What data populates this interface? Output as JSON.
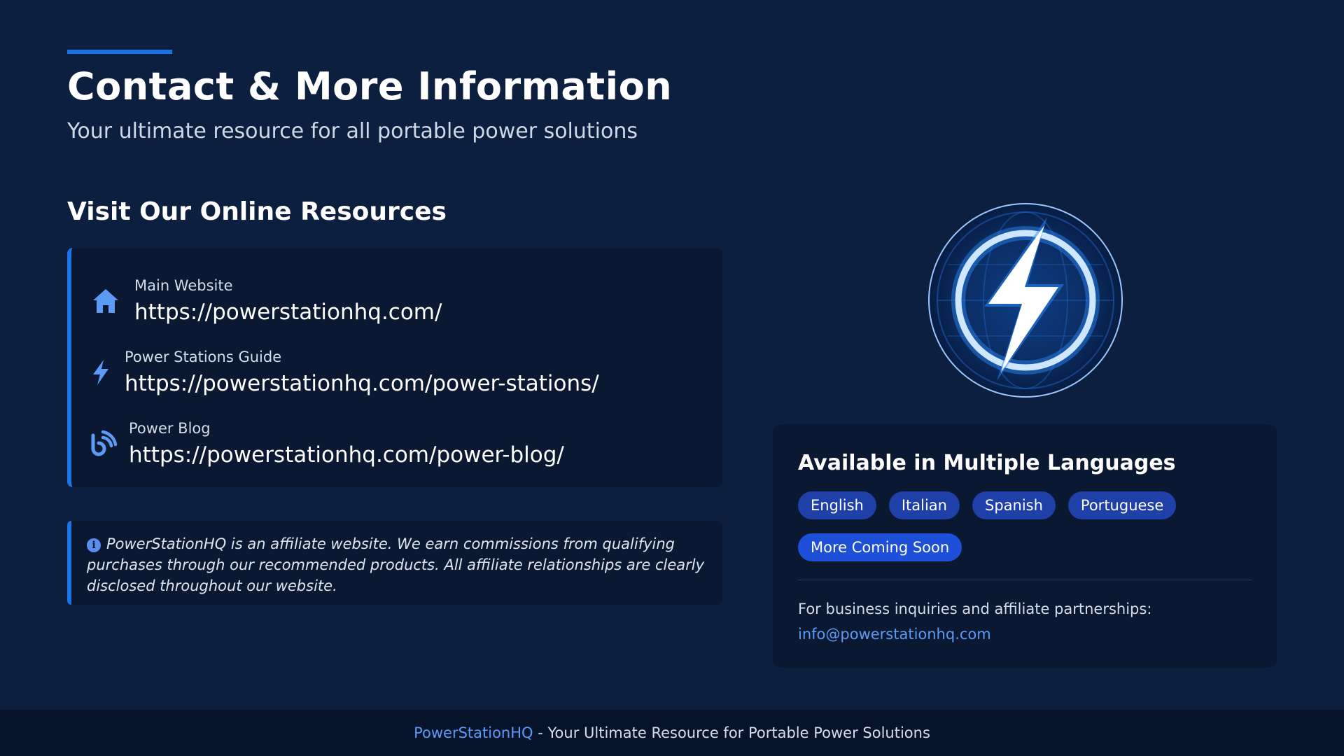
{
  "header": {
    "title": "Contact & More Information",
    "subtitle": "Your ultimate resource for all portable power solutions"
  },
  "resources": {
    "heading": "Visit Our Online Resources",
    "items": [
      {
        "label": "Main Website",
        "url": "https://powerstationhq.com/",
        "icon": "home-icon"
      },
      {
        "label": "Power Stations Guide",
        "url": "https://powerstationhq.com/power-stations/",
        "icon": "bolt-icon"
      },
      {
        "label": "Power Blog",
        "url": "https://powerstationhq.com/power-blog/",
        "icon": "blog-icon"
      }
    ]
  },
  "disclaimer": {
    "text": "PowerStationHQ is an affiliate website. We earn commissions from qualifying purchases through our recommended products. All affiliate relationships are clearly disclosed throughout our website.",
    "icon": "info-icon"
  },
  "languages": {
    "title": "Available in Multiple Languages",
    "tags": [
      "English",
      "Italian",
      "Spanish",
      "Portuguese",
      "More Coming Soon"
    ],
    "inquiry_text": "For business inquiries and affiliate partnerships:",
    "email": "info@powerstationhq.com"
  },
  "footer": {
    "brand": "PowerStationHQ",
    "tagline": " - Your Ultimate Resource for Portable Power Solutions"
  },
  "colors": {
    "background": "#0c1f3e",
    "card": "#0a1831",
    "accent": "#1a73e8",
    "link": "#5b9bf5",
    "tag": "#1e40a8"
  }
}
